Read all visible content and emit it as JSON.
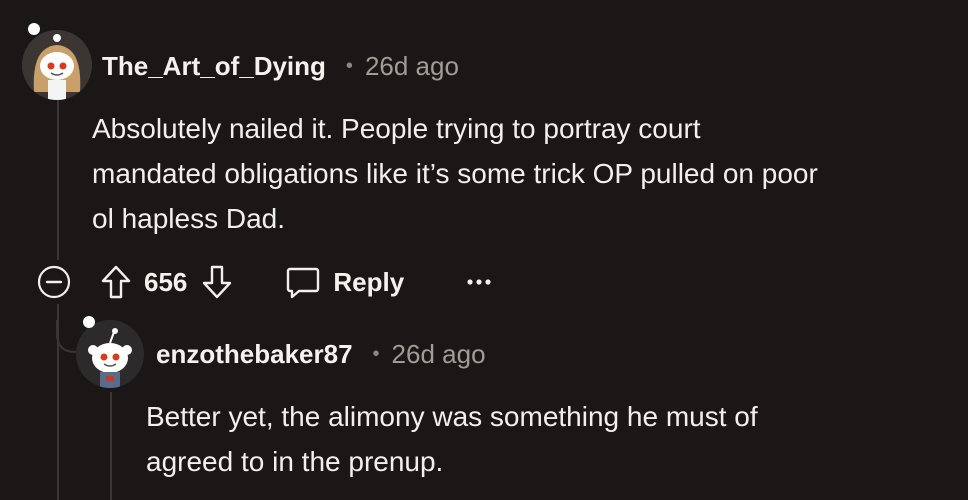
{
  "comments": [
    {
      "username": "The_Art_of_Dying",
      "separator": "•",
      "time": "26d ago",
      "avatar_icon": "snoo-avatar-long-hair-icon",
      "lines": [
        "Absolutely nailed it. People trying to portray court",
        "mandated obligations like it’s some trick OP pulled on poor",
        "ol hapless Dad."
      ],
      "votes": "656",
      "reply_label": "Reply"
    },
    {
      "username": "enzothebaker87",
      "separator": "•",
      "time": "26d ago",
      "avatar_icon": "snoo-avatar-icon",
      "lines": [
        "Better yet, the alimony was something he must of",
        "agreed to in the prenup."
      ]
    }
  ],
  "colors": {
    "background": "#1a1716",
    "text": "#f2f0ee",
    "muted": "#a29b97",
    "thread_line": "#3a3634",
    "snoo_eye": "#d9391e"
  }
}
